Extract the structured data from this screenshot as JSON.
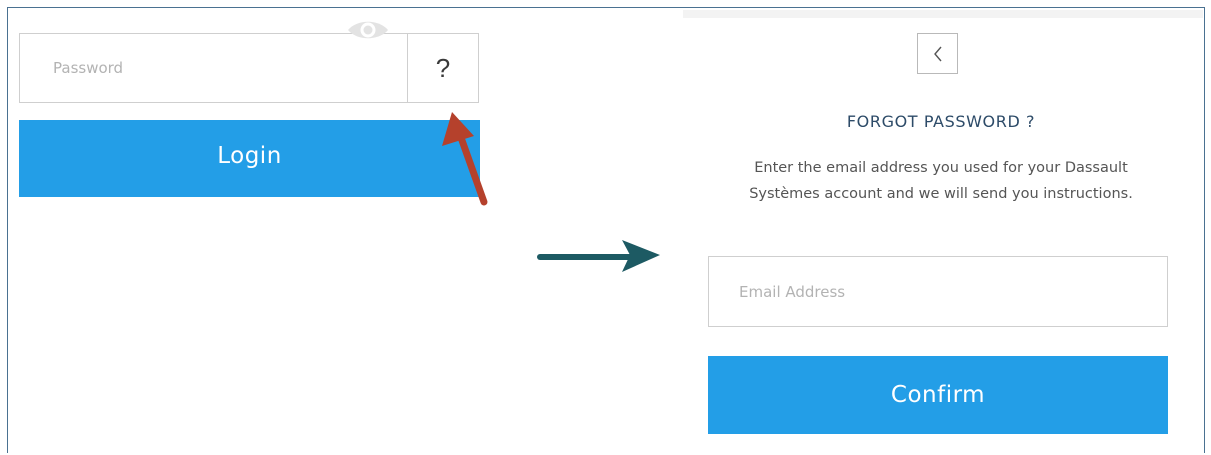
{
  "login_panel": {
    "password_placeholder": "Password",
    "help_label": "?",
    "login_label": "Login"
  },
  "forgot_panel": {
    "title": "FORGOT PASSWORD ?",
    "description": "Enter the email address you used for your Dassault Systèmes account and we will send you instructions.",
    "email_placeholder": "Email Address",
    "confirm_label": "Confirm"
  },
  "icons": {
    "eye": "eye-icon",
    "back": "chevron-left-icon",
    "annotation_red": "red-arrow-icon",
    "annotation_teal": "teal-arrow-icon"
  },
  "colors": {
    "accent": "#239ee7",
    "title": "#2d4b68",
    "red_arrow": "#b5412c",
    "teal_arrow": "#1d5a63"
  }
}
